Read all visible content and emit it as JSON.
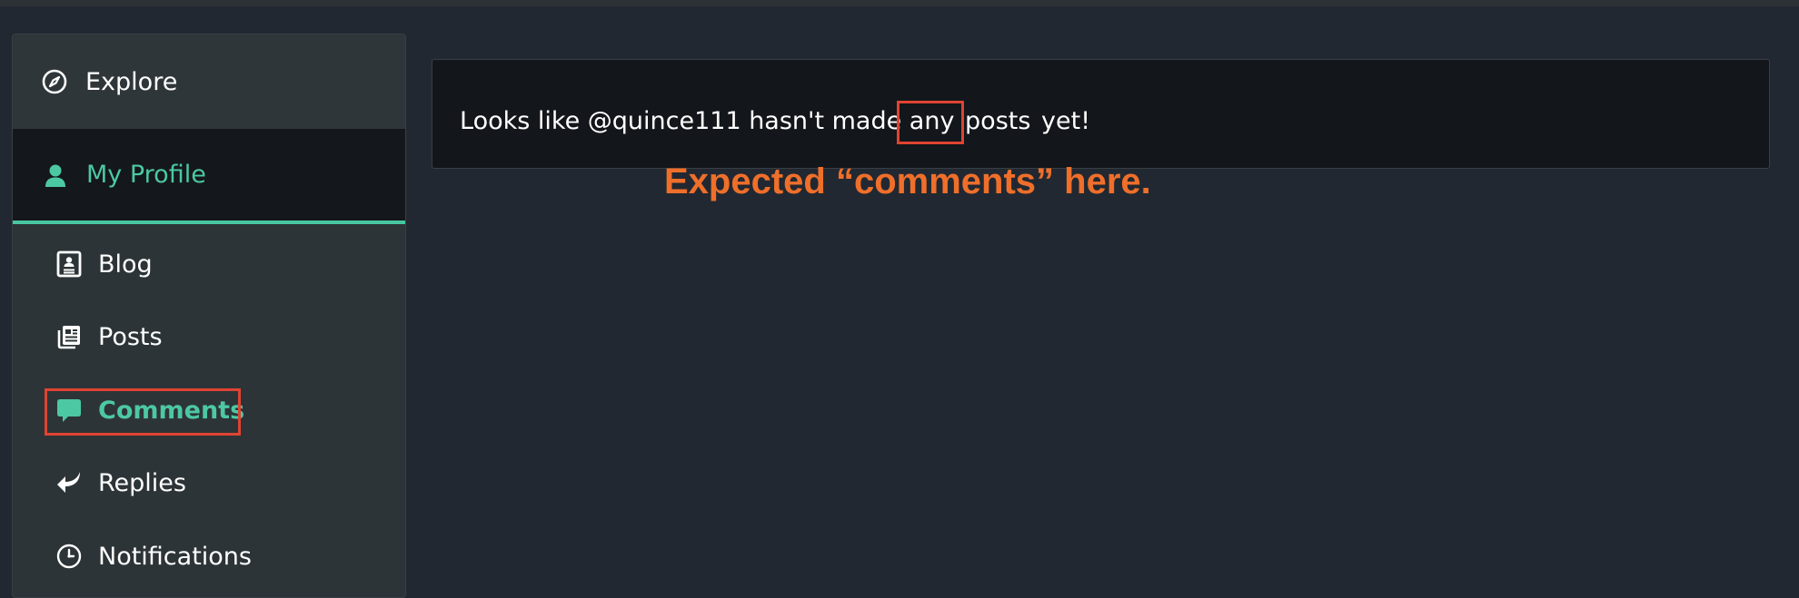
{
  "sidebar": {
    "items": [
      {
        "label": "Explore",
        "icon": "compass-icon"
      },
      {
        "label": "My Profile",
        "icon": "user-icon",
        "active": true
      }
    ],
    "subitems": [
      {
        "label": "Blog",
        "icon": "blog-icon"
      },
      {
        "label": "Posts",
        "icon": "posts-icon"
      },
      {
        "label": "Comments",
        "icon": "comment-icon",
        "active": true
      },
      {
        "label": "Replies",
        "icon": "reply-icon"
      },
      {
        "label": "Notifications",
        "icon": "clock-icon"
      }
    ]
  },
  "notice": {
    "prefix": "Looks like @quince111 hasn't made any",
    "highlighted_word": "posts",
    "suffix": "yet!"
  },
  "annotation": {
    "text": "Expected “comments” here."
  },
  "colors": {
    "accent": "#4cc8a3",
    "highlight": "#e04332",
    "annotation": "#ef6f2a",
    "background": "#222831"
  }
}
